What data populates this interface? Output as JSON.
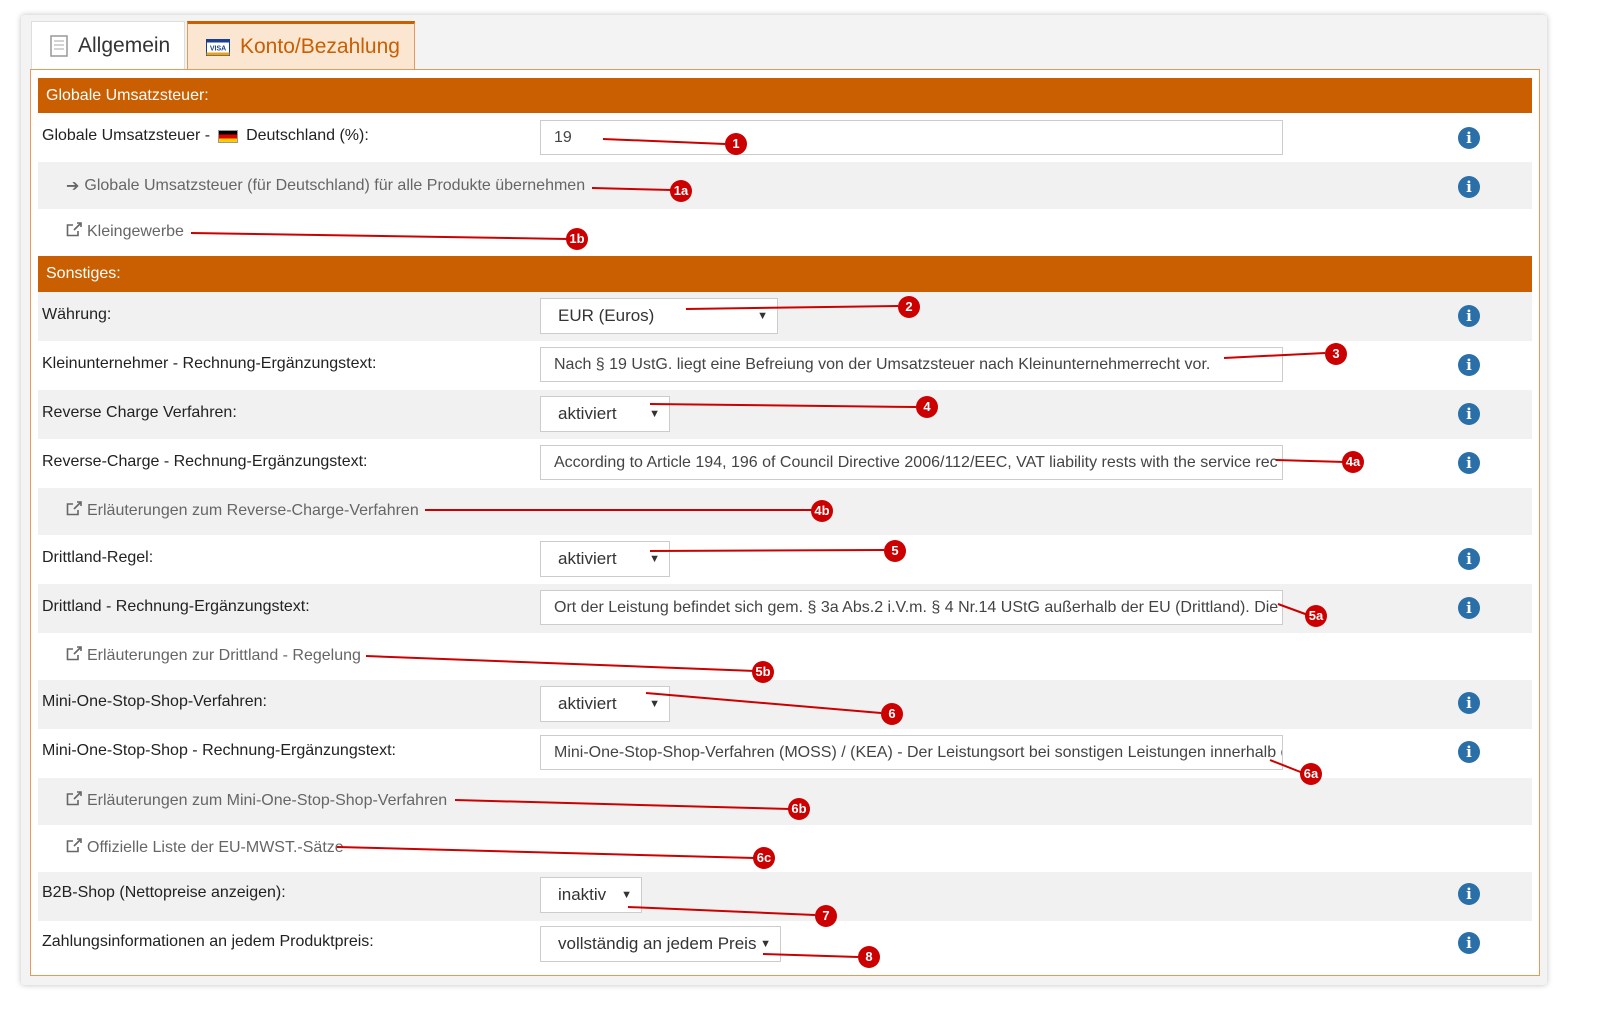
{
  "tabs": [
    {
      "label": "Allgemein",
      "icon": "document-icon"
    },
    {
      "label": "Konto/Bezahlung",
      "icon": "visa-card-icon"
    }
  ],
  "colors": {
    "accent": "#c95f00",
    "info": "#2a6fa8",
    "annotation": "#cc0000"
  },
  "sections": {
    "global_vat": "Globale Umsatzsteuer:",
    "other": "Sonstiges:"
  },
  "rows": {
    "vat_label_prefix": "Globale Umsatzsteuer -",
    "vat_label_suffix": "Deutschland (%):",
    "vat_value": "19",
    "vat_apply_link": "Globale Umsatzsteuer (für Deutschland) für alle Produkte übernehmen",
    "small_business_link": "Kleingewerbe",
    "currency_label": "Währung:",
    "currency_value": "EUR (Euros)",
    "small_business_text_label": "Kleinunternehmer - Rechnung-Ergänzungstext:",
    "small_business_text_value": "Nach § 19 UstG. liegt eine Befreiung von der Umsatzsteuer nach Kleinunternehmerrecht vor.",
    "reverse_charge_label": "Reverse Charge Verfahren:",
    "reverse_charge_value": "aktiviert",
    "reverse_charge_text_label": "Reverse-Charge - Rechnung-Ergänzungstext:",
    "reverse_charge_text_value": "According to Article 194, 196 of Council Directive 2006/112/EEC, VAT liability rests with the service rec",
    "reverse_charge_link": "Erläuterungen zum Reverse-Charge-Verfahren",
    "third_country_label": "Drittland-Regel:",
    "third_country_value": "aktiviert",
    "third_country_text_label": "Drittland - Rechnung-Ergänzungstext:",
    "third_country_text_value": "Ort der Leistung befindet sich gem. § 3a Abs.2 i.V.m. § 4 Nr.14 UStG außerhalb der EU (Drittland). Die L",
    "third_country_link": "Erläuterungen zur Drittland - Regelung",
    "moss_label": "Mini-One-Stop-Shop-Verfahren:",
    "moss_value": "aktiviert",
    "moss_text_label": "Mini-One-Stop-Shop - Rechnung-Ergänzungstext:",
    "moss_text_value": "Mini-One-Stop-Shop-Verfahren (MOSS) / (KEA) - Der Leistungsort bei sonstigen Leistungen innerhalb d",
    "moss_link": "Erläuterungen zum Mini-One-Stop-Shop-Verfahren",
    "eu_vat_list_link": "Offizielle Liste der EU-MWST.-Sätze",
    "b2b_label": "B2B-Shop (Nettopreise anzeigen):",
    "b2b_value": "inaktiv",
    "payment_info_label": "Zahlungsinformationen an jedem Produktpreis:",
    "payment_info_value": "vollständig an jedem Preis"
  },
  "badges": [
    "1",
    "1a",
    "1b",
    "2",
    "3",
    "4",
    "4a",
    "4b",
    "5",
    "5a",
    "5b",
    "6",
    "6a",
    "6b",
    "6c",
    "7",
    "8"
  ],
  "info_symbol": "i",
  "arrow_symbol": "▼"
}
